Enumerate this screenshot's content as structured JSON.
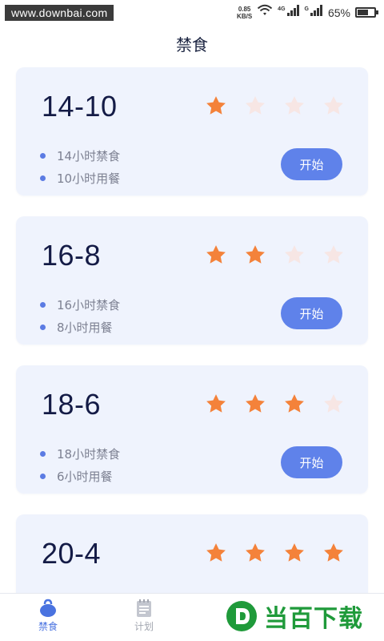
{
  "status_bar": {
    "watermark_url": "www.downbai.com",
    "net_speed_value": "0.85",
    "net_speed_unit": "KB/S",
    "sig1_label": "4G",
    "sig2_label": "G",
    "battery_percent": "65%",
    "battery_level": 0.65
  },
  "header": {
    "title": "禁食"
  },
  "colors": {
    "accent": "#5f82ea",
    "star_on": "#f4823a",
    "star_off": "#f7e6e4",
    "card_bg": "#eff3fd"
  },
  "plans": [
    {
      "name": "14-10",
      "rating": 1,
      "rating_max": 4,
      "fast_text": "14小时禁食",
      "eat_text": "10小时用餐",
      "button_label": "开始"
    },
    {
      "name": "16-8",
      "rating": 2,
      "rating_max": 4,
      "fast_text": "16小时禁食",
      "eat_text": "8小时用餐",
      "button_label": "开始"
    },
    {
      "name": "18-6",
      "rating": 3,
      "rating_max": 4,
      "fast_text": "18小时禁食",
      "eat_text": "6小时用餐",
      "button_label": "开始"
    },
    {
      "name": "20-4",
      "rating": 4,
      "rating_max": 4
    }
  ],
  "bottom_nav": {
    "items": [
      {
        "label": "禁食",
        "icon": "kettlebell-icon",
        "active": true
      },
      {
        "label": "计划",
        "icon": "notepad-icon",
        "active": false
      }
    ]
  },
  "brand": {
    "text": "当百下载",
    "icon": "d-letter-logo"
  }
}
